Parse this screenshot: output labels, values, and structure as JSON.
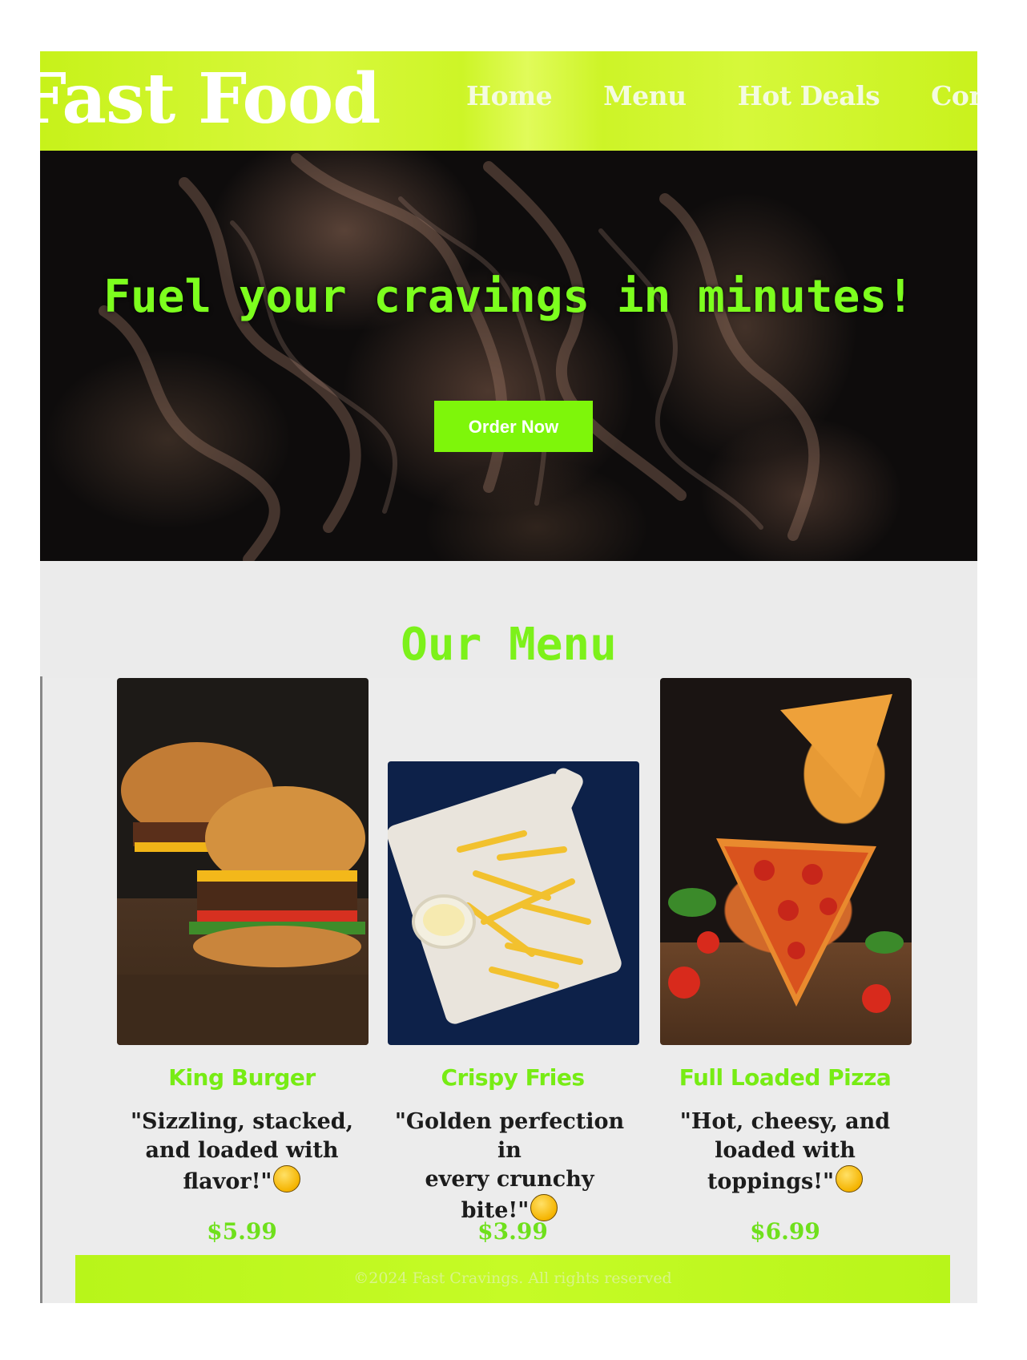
{
  "header": {
    "logo": "Fast Food",
    "nav": [
      "Home",
      "Menu",
      "Hot Deals",
      "Cont"
    ]
  },
  "hero": {
    "title": "Fuel your cravings in minutes!",
    "button": "Order Now"
  },
  "menu": {
    "heading": "Our Menu",
    "items": [
      {
        "name": "King Burger",
        "desc_line1": "\"Sizzling, stacked,",
        "desc_line2": "and loaded with",
        "desc_line3": "flavor!\"",
        "emoji": "tongue-out-face-icon",
        "price": "$5.99"
      },
      {
        "name": "Crispy Fries",
        "desc_line1": "\"Golden perfection in",
        "desc_line2": "every crunchy",
        "desc_line3": "bite!\"",
        "emoji": "smiling-face-icon",
        "price": "$3.99"
      },
      {
        "name": "Full Loaded Pizza",
        "desc_line1": "\"Hot, cheesy, and",
        "desc_line2": "loaded with",
        "desc_line3": "toppings!\"",
        "emoji": "yum-face-icon",
        "price": "$6.99"
      }
    ]
  },
  "footer": {
    "text": "©2024 Fast Cravings. All rights reserved"
  },
  "colors": {
    "accent_green": "#7dff1e",
    "header_green": "#cdf527",
    "hero_bg": "#0e0c0c",
    "page_bg": "#ececec"
  }
}
